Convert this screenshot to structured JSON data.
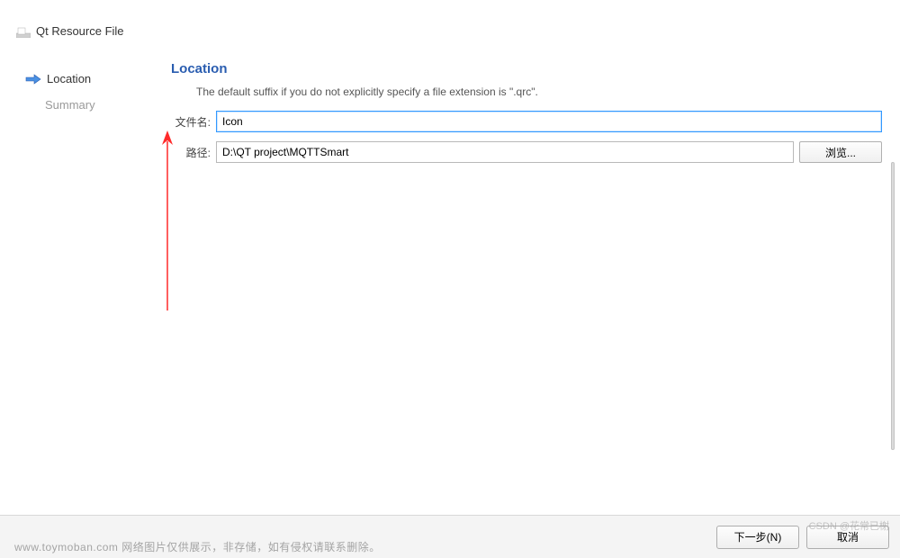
{
  "window": {
    "title": "Qt Resource File"
  },
  "sidebar": {
    "items": [
      {
        "label": "Location",
        "active": true
      },
      {
        "label": "Summary",
        "active": false
      }
    ]
  },
  "main": {
    "heading": "Location",
    "helper": "The default suffix if you do not explicitly specify a file extension is \".qrc\".",
    "filename_label": "文件名:",
    "filename_value": "Icon",
    "path_label": "路径:",
    "path_value": "D:\\QT project\\MQTTSmart",
    "browse_label": "浏览..."
  },
  "footer": {
    "next_label": "下一步(N)",
    "cancel_label": "取消"
  },
  "watermark": {
    "left": "www.toymoban.com 网络图片仅供展示，非存储，如有侵权请联系删除。",
    "right": "CSDN @花常已榭"
  }
}
